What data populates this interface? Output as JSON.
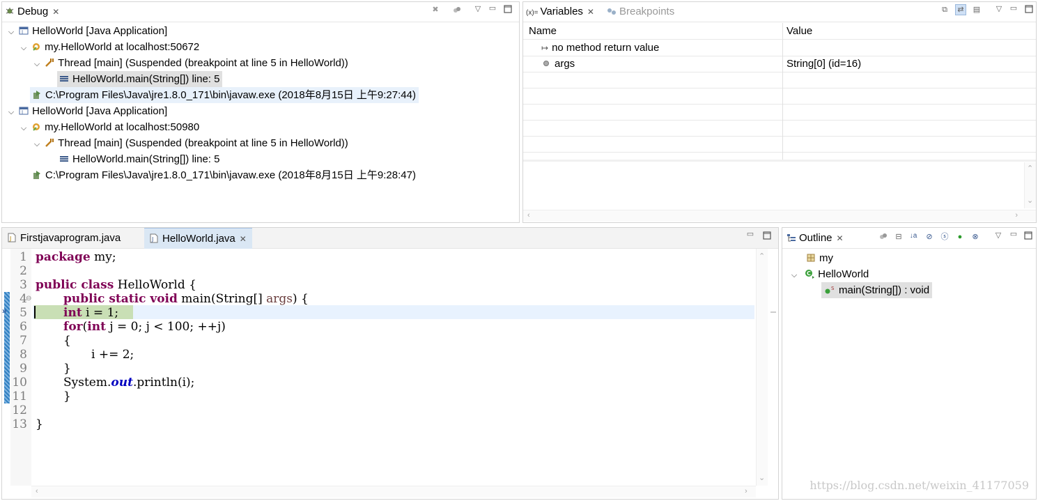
{
  "colors": {
    "accent": "#dae7f4",
    "selection": "#e0e0e0",
    "current_line": "#e8f2fe",
    "debug_highlight": "#c9dfb5",
    "keyword": "#7f0055",
    "field": "#0000c0",
    "param": "#6a3e3e"
  },
  "debug": {
    "tab_label": "Debug",
    "tree": [
      {
        "label": "HelloWorld [Java Application]",
        "icon": "java-app-icon"
      },
      {
        "label": "my.HelloWorld at localhost:50672",
        "icon": "debug-target-icon"
      },
      {
        "label": "Thread [main] (Suspended (breakpoint at line 5 in HelloWorld))",
        "icon": "thread-suspended-icon"
      },
      {
        "label": "HelloWorld.main(String[]) line: 5",
        "icon": "stack-frame-icon"
      },
      {
        "label": "C:\\Program Files\\Java\\jre1.8.0_171\\bin\\javaw.exe (2018年8月15日 上午9:27:44)",
        "icon": "process-icon"
      },
      {
        "label": "HelloWorld [Java Application]",
        "icon": "java-app-icon"
      },
      {
        "label": "my.HelloWorld at localhost:50980",
        "icon": "debug-target-icon"
      },
      {
        "label": "Thread [main] (Suspended (breakpoint at line 5 in HelloWorld))",
        "icon": "thread-suspended-icon"
      },
      {
        "label": "HelloWorld.main(String[]) line: 5",
        "icon": "stack-frame-icon"
      },
      {
        "label": "C:\\Program Files\\Java\\jre1.8.0_171\\bin\\javaw.exe (2018年8月15日 上午9:28:47)",
        "icon": "process-icon"
      }
    ]
  },
  "variables": {
    "tab_label": "Variables",
    "breakpoints_tab_label": "Breakpoints",
    "col_name": "Name",
    "col_value": "Value",
    "rows": [
      {
        "name": "no method return value",
        "value": ""
      },
      {
        "name": "args",
        "value": "String[0]  (id=16)"
      }
    ]
  },
  "editor": {
    "tabs": [
      {
        "label": "Firstjavaprogram.java"
      },
      {
        "label": "HelloWorld.java"
      }
    ],
    "line_numbers": [
      "1",
      "2",
      "3",
      "4",
      "5",
      "6",
      "7",
      "8",
      "9",
      "10",
      "11",
      "12",
      "13"
    ],
    "lines": {
      "l1_kw": "package",
      "l1_rest": " my;",
      "l3_kw": "public class",
      "l3_rest": " HelloWorld {",
      "l4_kw": "public static void",
      "l4_a": " main(String[] ",
      "l4_param": "args",
      "l4_b": ") {",
      "l5_kw": "int",
      "l5_rest": " i = 1;",
      "l6_kw1": "for",
      "l6_a": "(",
      "l6_kw2": "int",
      "l6_b": " j = 0; j < 100; ++j)",
      "l7": "{",
      "l8": "i += 2;",
      "l9": "}",
      "l10_a": "System.",
      "l10_field": "out",
      "l10_b": ".println(i);",
      "l11": "}",
      "l13": "}"
    }
  },
  "outline": {
    "tab_label": "Outline",
    "items": [
      {
        "label": "my",
        "icon": "package-icon"
      },
      {
        "label": "HelloWorld",
        "icon": "class-icon"
      },
      {
        "label": "main(String[]) : void",
        "icon": "public-method-icon"
      }
    ]
  },
  "watermark": "https://blog.csdn.net/weixin_41177059"
}
